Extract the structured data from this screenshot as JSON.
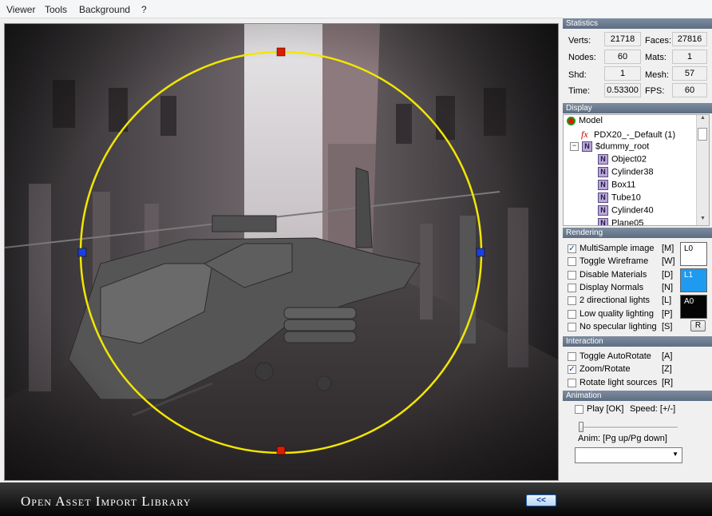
{
  "menu": [
    "Viewer",
    "Tools",
    "Background",
    "?"
  ],
  "statistics": {
    "header": "Statistics",
    "rows": [
      {
        "l1": "Verts:",
        "v1": "21718",
        "l2": "Faces:",
        "v2": "27816"
      },
      {
        "l1": "Nodes:",
        "v1": "60",
        "l2": "Mats:",
        "v2": "1"
      },
      {
        "l1": "Shd:",
        "v1": "1",
        "l2": "Mesh:",
        "v2": "57"
      },
      {
        "l1": "Time:",
        "v1": "0.53300",
        "l2": "FPS:",
        "v2": "60"
      }
    ]
  },
  "display": {
    "header": "Display",
    "tree": [
      {
        "label": "Model",
        "icon": "model-icon"
      },
      {
        "label": "PDX20_-_Default (1)",
        "icon": "fx-icon"
      },
      {
        "label": "$dummy_root",
        "icon": "node-icon"
      },
      {
        "label": "Object02",
        "icon": "node-icon"
      },
      {
        "label": "Cylinder38",
        "icon": "node-icon"
      },
      {
        "label": "Box11",
        "icon": "node-icon"
      },
      {
        "label": "Tube10",
        "icon": "node-icon"
      },
      {
        "label": "Cylinder40",
        "icon": "node-icon"
      },
      {
        "label": "Plane05",
        "icon": "node-icon"
      }
    ],
    "fx_glyph": "fx",
    "node_glyph": "N"
  },
  "rendering": {
    "header": "Rendering",
    "options": [
      {
        "label": "MultiSample image",
        "key": "[M]",
        "checked": true
      },
      {
        "label": "Toggle Wireframe",
        "key": "[W]",
        "checked": false
      },
      {
        "label": "Disable Materials",
        "key": "[D]",
        "checked": false
      },
      {
        "label": "Display Normals",
        "key": "[N]",
        "checked": false
      },
      {
        "label": "2 directional lights",
        "key": "[L]",
        "checked": false
      },
      {
        "label": "Low quality lighting",
        "key": "[P]",
        "checked": false
      },
      {
        "label": "No specular lighting",
        "key": "[S]",
        "checked": false
      }
    ],
    "swatches": [
      {
        "label": "L0",
        "color": "#ffffff"
      },
      {
        "label": "L1",
        "color": "#1e9af0"
      },
      {
        "label": "A0",
        "color": "#050505"
      }
    ],
    "reset_label": "R"
  },
  "interaction": {
    "header": "Interaction",
    "options": [
      {
        "label": "Toggle AutoRotate",
        "key": "[A]",
        "checked": false
      },
      {
        "label": "Zoom/Rotate",
        "key": "[Z]",
        "checked": true
      },
      {
        "label": "Rotate light sources",
        "key": "[R]",
        "checked": false
      }
    ]
  },
  "animation": {
    "header": "Animation",
    "play_label": "Play [OK]",
    "speed_label": "Speed: [+/-]",
    "anim_label": "Anim: [Pg up/Pg down]",
    "selected": "",
    "slider_level": 0
  },
  "footer": {
    "title": "Open Asset Import Library",
    "collapse_label": "<<"
  },
  "colors": {
    "ring": "#f2e600",
    "handle_top_bottom": "#e01a00",
    "handle_sides": "#1a3fe0",
    "accent": "#1e9af0"
  }
}
